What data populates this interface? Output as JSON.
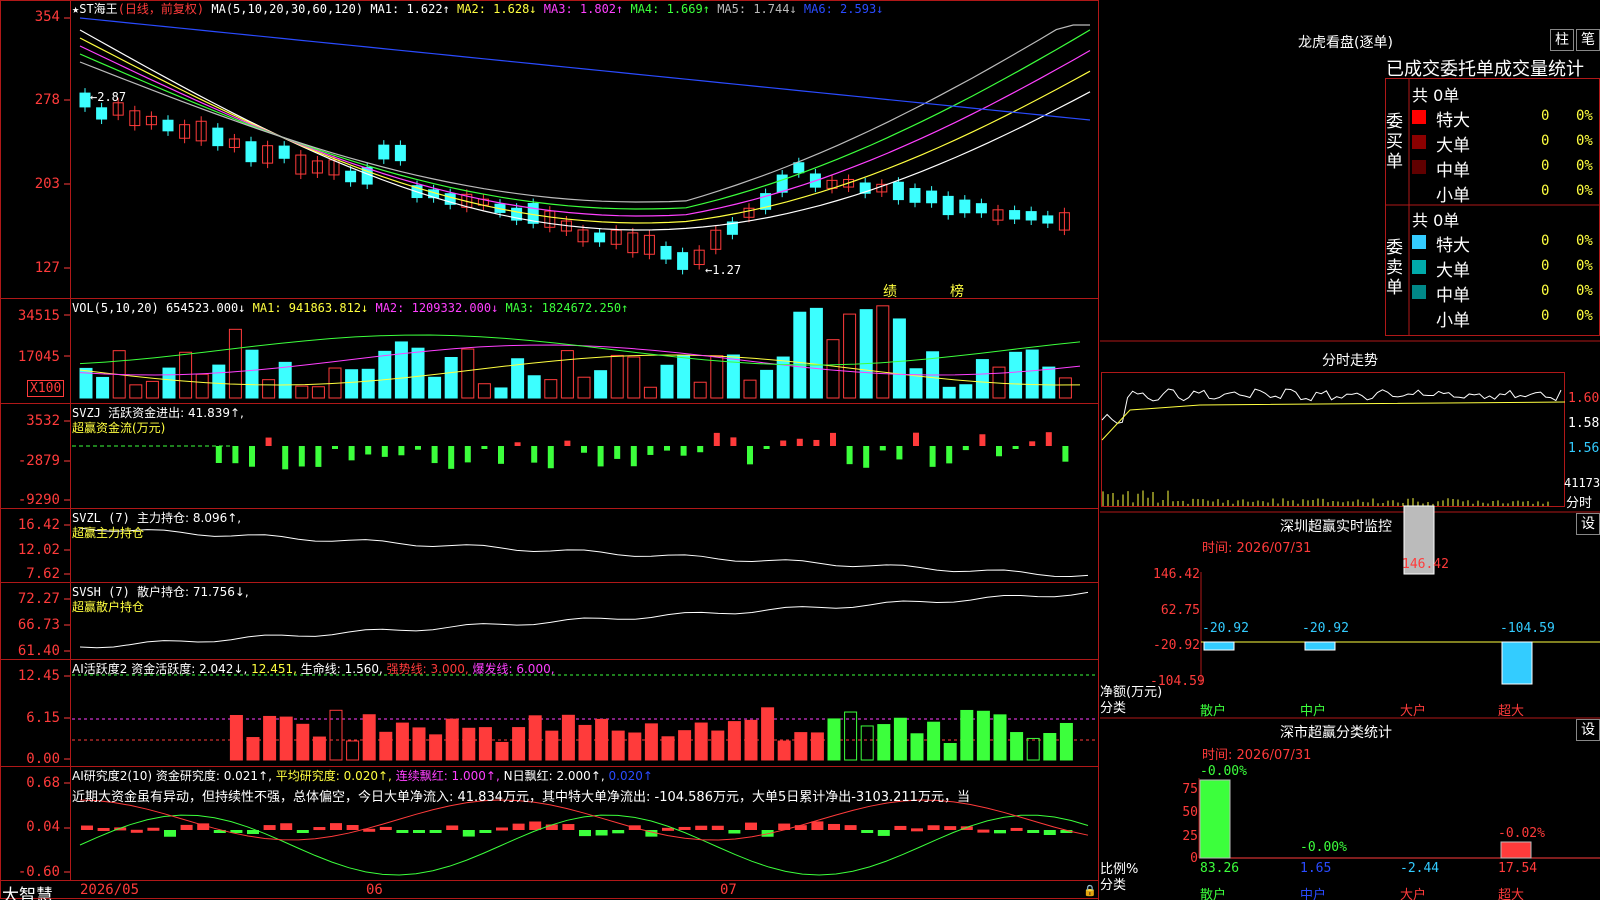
{
  "price_panel": {
    "legend_name": "★ST海王",
    "legend_mode": "(日线，前复权)",
    "legend_ma": "MA(5,10,20,30,60,120)",
    "ma": [
      "MA1: 1.622↑",
      "MA2: 1.628↓",
      "MA3: 1.802↑",
      "MA4: 1.669↑",
      "MA5: 1.744↓",
      "MA6: 2.593↓"
    ],
    "ma_colors": [
      "#ffffff",
      "#ffff40",
      "#ff40ff",
      "#3cff3c",
      "#bbbbbb",
      "#2a4bff"
    ],
    "y_ticks": [
      "354",
      "278",
      "203",
      "127"
    ],
    "high_mark": "2.87",
    "low_mark": "1.27",
    "flags": [
      "绩",
      "榜"
    ]
  },
  "vol_panel": {
    "title": "VOL(5,10,20)",
    "value": "654523.000↓",
    "ma": [
      "MA1: 941863.812↓",
      "MA2: 1209332.000↓",
      "MA3: 1824672.250↑"
    ],
    "y_ticks": [
      "34515",
      "17045"
    ],
    "unit": "X100"
  },
  "svzj_panel": {
    "title": "SVZJ",
    "name": "活跃资金进出: 41.839↑,",
    "sub": "超赢资金流(万元)",
    "y_ticks": [
      "3532",
      "-2879",
      "-9290"
    ]
  },
  "svzl_panel": {
    "title": "SVZL (7)",
    "name": "主力持仓: 8.096↑,",
    "sub": "超赢主力持仓",
    "y_ticks": [
      "16.42",
      "12.02",
      "7.62"
    ]
  },
  "svsh_panel": {
    "title": "SVSH (7)",
    "name": "散户持仓: 71.756↓,",
    "sub": "超赢散户持仓",
    "y_ticks": [
      "72.27",
      "66.73",
      "61.40"
    ]
  },
  "ai_active": {
    "title": "AI活跃度2",
    "items": [
      "资金活跃度: 2.042↓,",
      "12.451,",
      "生命线: 1.560,",
      "强势线: 3.000,",
      "爆发线: 6.000,"
    ],
    "y_ticks": [
      "12.45",
      "6.15",
      "0.00"
    ]
  },
  "ai_research": {
    "title": "AI研究度2(10)",
    "items": [
      "资金研究度: 0.021↑,",
      "平均研究度: 0.020↑,",
      "连续飘红: 1.000↑,",
      "N日飘红: 2.000↑,",
      "0.020↑"
    ],
    "commentary": "近期大资金虽有异动，但持续性不强，总体偏空，今日大单净流入: 41.834万元，其中特大单净流出: -104.586万元，大单5日累计净出-3103.211万元，当",
    "y_ticks": [
      "0.68",
      "0.04",
      "-0.60"
    ]
  },
  "x_axis": {
    "labels": [
      "2026/05",
      "06",
      "07"
    ],
    "brand": "大智慧"
  },
  "dragon": {
    "title": "龙虎看盘(逐单)",
    "btn_a": "柱",
    "btn_b": "笔",
    "header": "已成交委托单成交量统计",
    "buy_label": "委买单",
    "sell_label": "委卖单",
    "total_buy": "共 0单",
    "total_sell": "共 0单",
    "rows": [
      "特大",
      "大单",
      "中单",
      "小单"
    ],
    "val": "0",
    "pct": "0%"
  },
  "intraday": {
    "title": "分时走势",
    "ticks": [
      "1.600",
      "1.580",
      "1.560"
    ],
    "vol": "41173",
    "label": "分时"
  },
  "monitor": {
    "title": "深圳超赢实时监控",
    "btn": "设",
    "time": "时间: 2026/07/31",
    "y_ticks": [
      "146.42",
      "62.75",
      "-20.92",
      "-104.59"
    ],
    "bars": [
      {
        "cat": "散户",
        "val": "-20.92"
      },
      {
        "cat": "中户",
        "val": "-20.92"
      },
      {
        "cat": "大户",
        "val": "146.42"
      },
      {
        "cat": "超大",
        "val": "-104.59"
      }
    ],
    "ylabel": "净额(万元)",
    "xlabel": "分类"
  },
  "classify": {
    "title": "深市超赢分类统计",
    "btn": "设",
    "time": "时间: 2026/07/31",
    "y_ticks": [
      "75",
      "50",
      "25",
      "0"
    ],
    "bars": [
      {
        "cat": "散户",
        "top": "-0.00%",
        "val": "83.26"
      },
      {
        "cat": "中户",
        "top": "-0.00%",
        "val": "1.65"
      },
      {
        "cat": "大户",
        "top": "",
        "val": "-2.44"
      },
      {
        "cat": "超大",
        "top": "-0.02%",
        "val": "17.54"
      }
    ],
    "ylabel": "比例%",
    "xlabel": "分类"
  },
  "chart_data": {
    "type": "bar",
    "categories": [
      "散户",
      "中户",
      "大户",
      "超大"
    ],
    "series": [
      {
        "name": "净额(万元)",
        "values": [
          -20.92,
          -20.92,
          146.42,
          -104.59
        ]
      },
      {
        "name": "比例%",
        "values": [
          83.26,
          1.65,
          -2.44,
          17.54
        ]
      }
    ]
  }
}
